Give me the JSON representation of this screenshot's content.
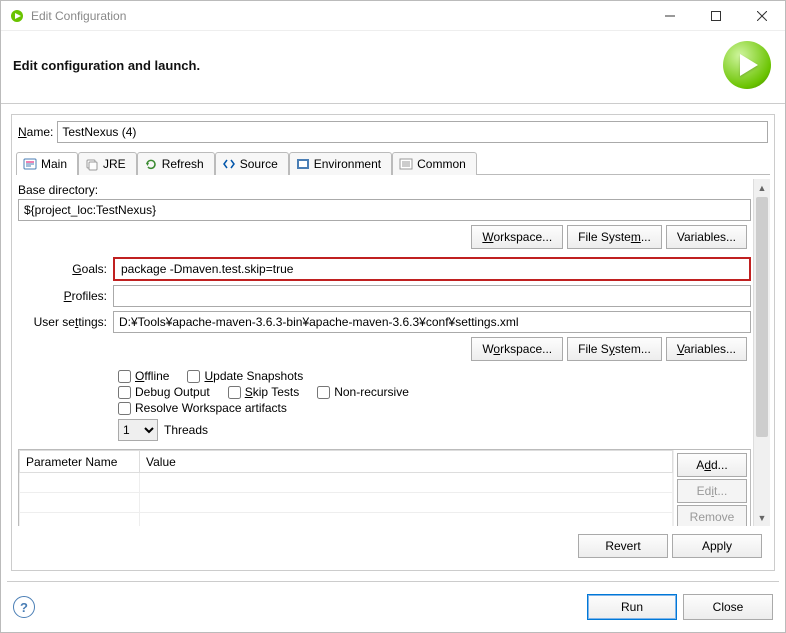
{
  "window": {
    "title": "Edit Configuration",
    "header": "Edit configuration and launch."
  },
  "name_field": {
    "label": "Name:",
    "value": "TestNexus (4)"
  },
  "tabs": [
    {
      "label": "Main"
    },
    {
      "label": "JRE"
    },
    {
      "label": "Refresh"
    },
    {
      "label": "Source"
    },
    {
      "label": "Environment"
    },
    {
      "label": "Common"
    }
  ],
  "fields": {
    "base_dir_label": "Base directory:",
    "base_dir_value": "${project_loc:TestNexus}",
    "goals_label": "Goals:",
    "goals_value": "package -Dmaven.test.skip=true",
    "profiles_label": "Profiles:",
    "profiles_value": "",
    "user_settings_label": "User settings:",
    "user_settings_value": "D:¥Tools¥apache-maven-3.6.3-bin¥apache-maven-3.6.3¥conf¥settings.xml"
  },
  "buttons": {
    "workspace": "Workspace...",
    "file_system": "File System...",
    "variables": "Variables...",
    "add": "Add...",
    "edit": "Edit...",
    "remove": "Remove",
    "revert": "Revert",
    "apply": "Apply",
    "run": "Run",
    "close": "Close"
  },
  "checks": {
    "offline": "Offline",
    "update_snapshots": "Update Snapshots",
    "debug_output": "Debug Output",
    "skip_tests": "Skip Tests",
    "non_recursive": "Non-recursive",
    "resolve_ws": "Resolve Workspace artifacts"
  },
  "threads": {
    "value": "1",
    "label": "Threads"
  },
  "table": {
    "col_name": "Parameter Name",
    "col_value": "Value"
  }
}
